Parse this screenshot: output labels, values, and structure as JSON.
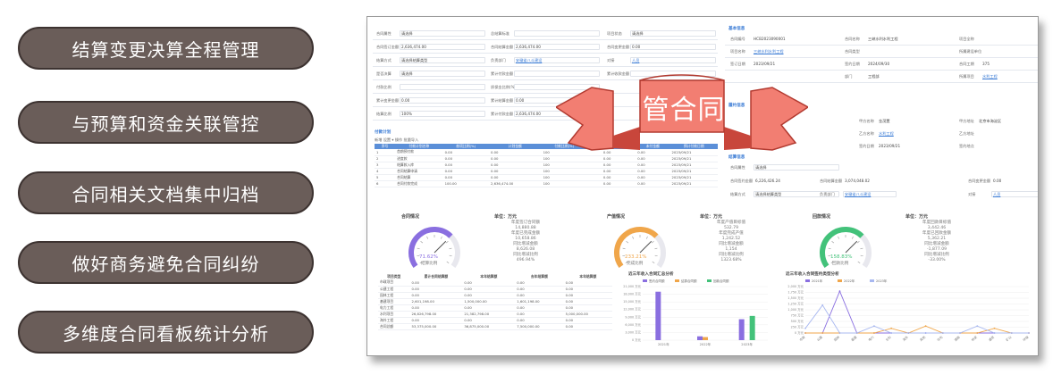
{
  "features": [
    "结算变更决算全程管理",
    "与预算和资金关联管控",
    "合同相关文档集中归档",
    "做好商务避免合同纠纷",
    "多维度合同看板统计分析"
  ],
  "ribbon_text": "管合同",
  "screenshot": {
    "form_left": {
      "rows": [
        {
          "label": "合同属性",
          "value": "请选择",
          "label2": "总结算标准",
          "value2": "",
          "label3": "项目状态",
          "value3": "请选择"
        },
        {
          "label": "合同签订金额",
          "value": "2,636,474.00",
          "label2": "合同结算金额",
          "value2": "2,636,474.00",
          "label3": "合同变更金额",
          "value3": "0.00"
        },
        {
          "label": "结算方式",
          "value": "请选择结算类型",
          "label2": "负责部门",
          "value2": "安徽省八斗建设",
          "label3": "对接",
          "value3": "人员"
        },
        {
          "label": "是否决算",
          "value": "请选择",
          "label2": "累计付款金额",
          "value2": "",
          "label3": "累计收款金额",
          "value3": ""
        },
        {
          "label": "付款比例",
          "value": "",
          "label2": "质保金比例(%)",
          "value2": "",
          "label3": "",
          "value3": ""
        },
        {
          "label": "累计变更金额",
          "value": "0.00",
          "label2": "累计结算金额",
          "value2": "0.00",
          "label3": "",
          "value3": ""
        },
        {
          "label": "结算比例",
          "value": "100%",
          "label2": "累计付款金额",
          "value2": "2,636,474.00",
          "label3": "",
          "value3": ""
        }
      ]
    },
    "form_right": {
      "section1": "基本信息",
      "section2": "履约信息",
      "rows": [
        {
          "label": "合同编号",
          "value": "HCB2023090001",
          "label2": "合同名称",
          "value2": "三峡水利水利工程",
          "label3": "项目全称",
          "value3": ""
        },
        {
          "label": "项目名称",
          "value": "三峡水利水利工程",
          "label2": "合同类型",
          "value2": "",
          "label3": "所属建设单位",
          "value3": ""
        },
        {
          "label": "签订日期",
          "value": "2023/09/21",
          "label2": "签约日期",
          "value2": "2024/09/30",
          "label3": "合同工期",
          "value3": "375"
        },
        {
          "label": "",
          "value": "",
          "label2": "部门",
          "value2": "工程部",
          "label3": "所属项目",
          "value3": "水利工程"
        }
      ],
      "party_rows": [
        {
          "label": "甲方名称",
          "value": "金茂置",
          "label2": "甲方地址",
          "value2": "北京市海淀区"
        },
        {
          "label": "乙方名称",
          "value": "水利工程",
          "label2": "乙方地址",
          "value2": ""
        },
        {
          "label": "签约日期",
          "value": "2023/09/21",
          "label2": "签约地点",
          "value2": ""
        }
      ]
    },
    "settle_panel": {
      "title": "结算信息",
      "rows": [
        {
          "label": "合同属性",
          "value": "请选择"
        },
        {
          "label": "合同签约金额",
          "value": "6,226,426.24",
          "label2": "合同结算金额",
          "value2": "3,074,048.02",
          "label3": "合同变更金额",
          "value3": "0.00"
        },
        {
          "label": "结算方式",
          "value": "请选择结算类型",
          "label2": "负责部门",
          "value2": "安徽省八斗建设",
          "label3": "对接",
          "value3": "人员"
        }
      ]
    },
    "payment_table": {
      "title": "付款计划",
      "toolbar": "新增  设置  ▾  操作  批量导入",
      "headers": [
        "序号",
        "付款计划名称",
        "款项比例(%)",
        "计划金额",
        "付款比例(%)",
        "",
        "",
        "已付金额",
        "未付金额",
        "预计付款日期"
      ],
      "rows": [
        [
          "1",
          "首期预付款",
          "0.00",
          "0.00",
          "100",
          "",
          "",
          "0.00",
          "0.00",
          "2023/09/21"
        ],
        [
          "2",
          "进度款",
          "0.00",
          "0.00",
          "100",
          "",
          "",
          "0.00",
          "0.00",
          "2023/09/21"
        ],
        [
          "3",
          "结算款入库",
          "0.00",
          "0.00",
          "100",
          "",
          "",
          "0.00",
          "0.00",
          "2023/09/21"
        ],
        [
          "4",
          "合同结算申请",
          "0.00",
          "0.00",
          "100",
          "",
          "",
          "0.00",
          "0.00",
          "2023/09/21"
        ],
        [
          "5",
          "合同结算",
          "0.00",
          "0.00",
          "100",
          "",
          "",
          "0.00",
          "0.00",
          "2023/09/21"
        ],
        [
          "6",
          "合同付款完成",
          "100.00",
          "2,636,474.00",
          "100",
          "",
          "",
          "0.00",
          "0.00",
          "2023/09/21"
        ]
      ]
    },
    "gauges": [
      {
        "title": "合同情况",
        "unit": "单位：万元",
        "percent": "71.62%",
        "label": "结算比例",
        "color": "#8a6fe0",
        "info": [
          "年度签订合同额",
          "14,880.88",
          "年度已完成金额",
          "10,658.86",
          "同比增减金额",
          "8,626.08",
          "同比增减比例",
          "496.94%"
        ]
      },
      {
        "title": "产值情况",
        "unit": "单位：万元",
        "percent": "233.21%",
        "label": "完成比例",
        "color": "#f0a64a",
        "info": [
          "年度产值目标值",
          "532.79",
          "年度完成产值",
          "1,242.52",
          "同比增减金额",
          "1,154",
          "同比增减比例",
          "1323.68%"
        ]
      },
      {
        "title": "回款情况",
        "unit": "单位：万元",
        "percent": "158.83%",
        "label": "回款比例",
        "color": "#43c27a",
        "info": [
          "年度回款目标值",
          "3,442.46",
          "年度已回款金额",
          "5,362.21",
          "同比增减金额",
          "-1,877.09",
          "同比增减比例",
          "-33.00%"
        ]
      }
    ],
    "stat_table": {
      "headers": [
        "项目类型",
        "累计合同结算额",
        "本年结算额",
        "去年结算额",
        "本年结算额"
      ],
      "rows": [
        [
          "市政项目",
          "0.00",
          "0.00",
          "0.00",
          "0.00"
        ],
        [
          "公建工程",
          "0.00",
          "0.00",
          "0.00",
          "0.00"
        ],
        [
          "园林工程",
          "0.00",
          "0.00",
          "0.00",
          "0.00"
        ],
        [
          "基建项目",
          "2,601,198.00",
          "1,500,000.00",
          "1,601,198.00",
          "0.00"
        ],
        [
          "电力工程",
          "0.00",
          "0.00",
          "0.00",
          "0.00"
        ],
        [
          "水利项目",
          "26,826,798.00",
          "21,382,798.00",
          "0.00",
          "5,000,000.00"
        ],
        [
          "海外工程",
          "0.00",
          "0.00",
          "0.00",
          "0.00"
        ],
        [
          "合同总额",
          "53,375,000.00",
          "36,875,000.00",
          "7,500,000.00",
          "0.00"
        ]
      ]
    },
    "bar_chart_title": "近三年收入合同汇总分析",
    "line_chart_title": "近三年收入合同签约类型分析"
  },
  "chart_data": [
    {
      "type": "bar",
      "title": "近三年收入合同汇总分析",
      "categories": [
        "2021年",
        "2022年",
        "2023年"
      ],
      "series": [
        {
          "name": "签约合同额",
          "values": [
            19000,
            1500,
            8200
          ],
          "color": "#8a6fe0"
        },
        {
          "name": "结算合同额",
          "values": [
            0,
            1200,
            0
          ],
          "color": "#f0a64a"
        },
        {
          "name": "回款合同额",
          "values": [
            0,
            0,
            9500
          ],
          "color": "#43c27a"
        }
      ],
      "ylim": [
        0,
        21000
      ]
    },
    {
      "type": "line",
      "title": "近三年收入合同签约类型分析",
      "categories": [
        "市政",
        "公建",
        "园林",
        "基建",
        "电力",
        "水利",
        "海外",
        "其他",
        "住宅",
        "道路",
        "桥梁",
        "通信",
        "矿山",
        "环保"
      ],
      "series": [
        {
          "name": "2021年",
          "values": [
            0,
            0,
            1800,
            0,
            0,
            0,
            0,
            0,
            0,
            0,
            0,
            0,
            0,
            0
          ],
          "color": "#8a6fe0"
        },
        {
          "name": "2022年",
          "values": [
            0,
            0,
            0,
            0,
            0,
            200,
            0,
            300,
            0,
            0,
            0,
            200,
            0,
            0
          ],
          "color": "#f0a64a"
        },
        {
          "name": "2023年",
          "values": [
            200,
            1200,
            0,
            0,
            300,
            0,
            0,
            0,
            0,
            0,
            300,
            0,
            0,
            0
          ],
          "color": "#a8b8f0"
        }
      ],
      "ylim": [
        0,
        2000
      ]
    }
  ]
}
